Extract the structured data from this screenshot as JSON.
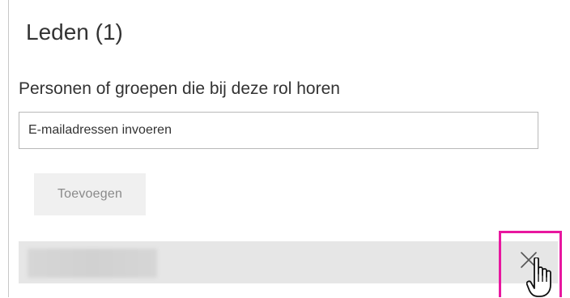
{
  "panel": {
    "title": "Leden (1)",
    "members_label": "Personen of groepen die bij deze rol horen",
    "email_input": {
      "placeholder": "E-mailadressen invoeren",
      "value": ""
    },
    "add_button_label": "Toevoegen",
    "members": [
      {
        "name": "",
        "name_obscured": true
      }
    ]
  },
  "icons": {
    "remove": "close-icon",
    "pointer": "hand-pointer-icon"
  },
  "colors": {
    "highlight": "#e8179f",
    "row_background": "#e6e6e6",
    "button_background": "#f0f0f0",
    "text": "#333333",
    "disabled_text": "#8a8a8a"
  }
}
